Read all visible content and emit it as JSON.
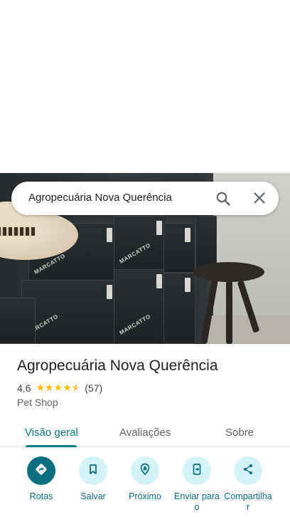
{
  "search": {
    "query": "Agropecuária Nova Querência",
    "search_icon": "search-icon",
    "clear_icon": "close-icon"
  },
  "photo": {
    "box_brand_text": "MARCATTO"
  },
  "place": {
    "name": "Agropecuária Nova Querência",
    "rating": "4,6",
    "rating_value": 4.6,
    "review_count": "(57)",
    "category": "Pet Shop"
  },
  "tabs": [
    {
      "label": "Visão geral",
      "active": true
    },
    {
      "label": "Avaliações",
      "active": false
    },
    {
      "label": "Sobre",
      "active": false
    }
  ],
  "actions": [
    {
      "label": "Rotas",
      "icon": "directions-icon"
    },
    {
      "label": "Salvar",
      "icon": "bookmark-icon"
    },
    {
      "label": "Próximo",
      "icon": "nearby-icon"
    },
    {
      "label": "Enviar para o",
      "icon": "send-to-phone-icon"
    },
    {
      "label": "Compartilha r",
      "icon": "share-icon"
    }
  ],
  "colors": {
    "accent": "#0b6f80",
    "accent_light": "#d3f3f8",
    "star": "#fbbc04"
  }
}
